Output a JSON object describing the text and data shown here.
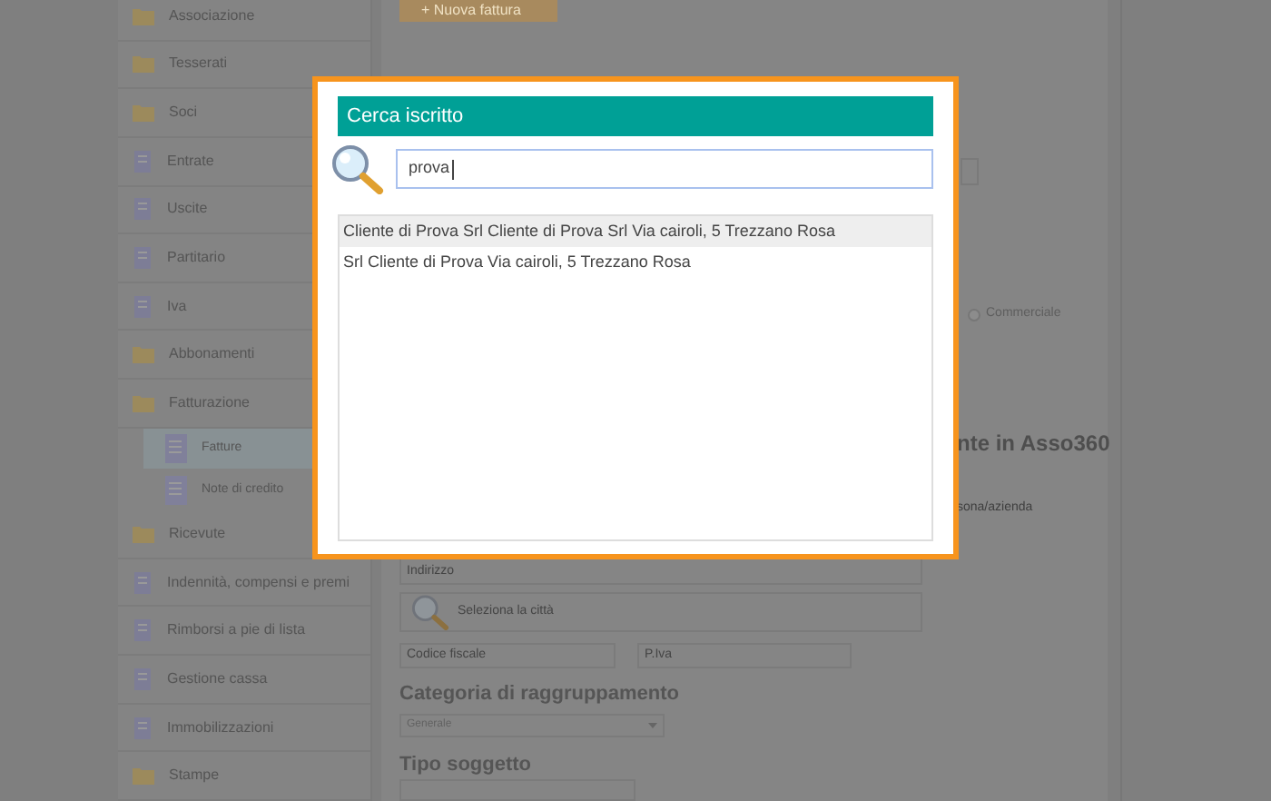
{
  "sidebar": {
    "items": [
      {
        "label": "Associazione",
        "kind": "folder",
        "selected": false
      },
      {
        "label": "Tesserati",
        "kind": "folder",
        "selected": false
      },
      {
        "label": "Soci",
        "kind": "folder",
        "selected": false
      },
      {
        "label": "Entrate",
        "kind": "page",
        "selected": false
      },
      {
        "label": "Uscite",
        "kind": "page",
        "selected": false
      },
      {
        "label": "Partitario",
        "kind": "page",
        "selected": false
      },
      {
        "label": "Iva",
        "kind": "page",
        "selected": false
      },
      {
        "label": "Abbonamenti",
        "kind": "folder",
        "selected": false
      },
      {
        "label": "Fatturazione",
        "kind": "folder",
        "selected": false,
        "children": [
          {
            "label": "Fatture",
            "kind": "doc",
            "selected": true
          },
          {
            "label": "Note di credito",
            "kind": "doc",
            "selected": false
          }
        ]
      },
      {
        "label": "Ricevute",
        "kind": "folder",
        "selected": false
      },
      {
        "label": "Indennità, compensi e premi",
        "kind": "page",
        "selected": false
      },
      {
        "label": "Rimborsi a pie di lista",
        "kind": "page",
        "selected": false
      },
      {
        "label": "Gestione cassa",
        "kind": "page",
        "selected": false
      },
      {
        "label": "Immobilizzazioni",
        "kind": "page",
        "selected": false
      },
      {
        "label": "Stampe",
        "kind": "folder",
        "selected": false
      }
    ]
  },
  "main": {
    "new_button": "+ Nuova fattura",
    "radio_label": "Commerciale",
    "radio_checked": false,
    "section_heading_fragment": "nte in Asso360",
    "field_hint_fragment": "sona/azienda",
    "address_placeholder": "Indirizzo",
    "city_placeholder": "Seleziona la città",
    "tax_code_placeholder": "Codice fiscale",
    "vat_placeholder": "P.Iva",
    "group_heading": "Categoria di raggruppamento",
    "group_value": "Generale",
    "type_heading": "Tipo soggetto"
  },
  "dialog": {
    "title": "Cerca iscritto",
    "search_value": "prova",
    "results": [
      {
        "text": "Cliente di Prova Srl Cliente di Prova Srl Via cairoli, 5 Trezzano Rosa",
        "selected": true
      },
      {
        "text": "Srl Cliente di Prova Via cairoli, 5 Trezzano Rosa",
        "selected": false
      }
    ]
  }
}
